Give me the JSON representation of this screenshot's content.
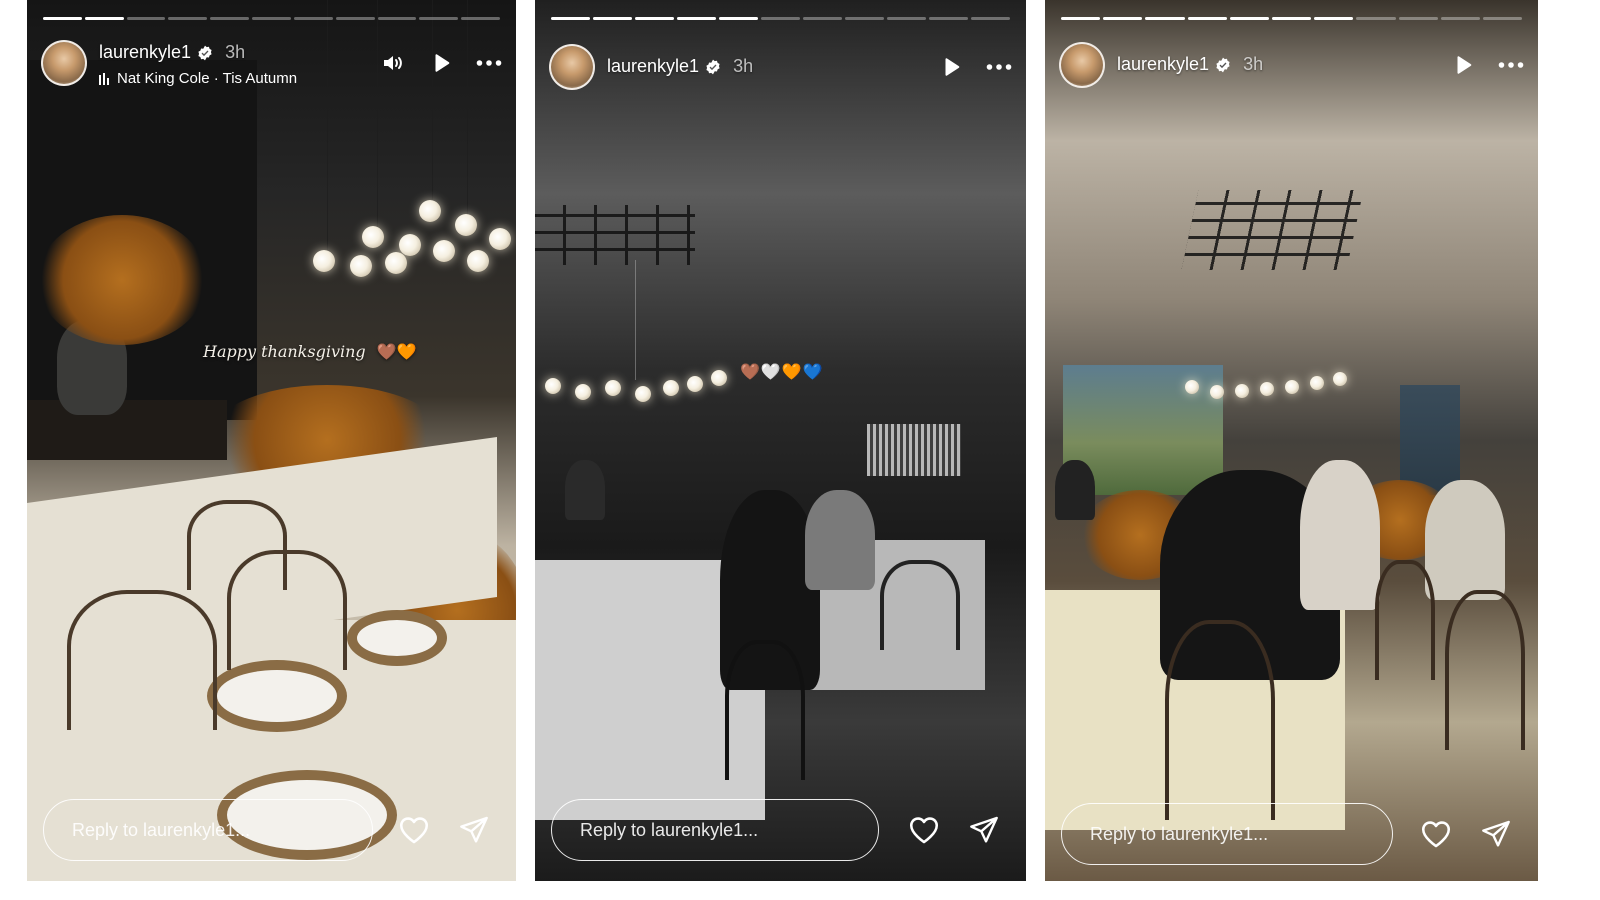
{
  "stories": [
    {
      "progress": {
        "total": 11,
        "done": 2
      },
      "username": "laurenkyle1",
      "time": "3h",
      "music": "Nat King Cole · Tis Autumn",
      "caption": "Happy thanksgiving",
      "caption_emoji": "🤎🧡",
      "reply_placeholder": "Reply to laurenkyle1..."
    },
    {
      "progress": {
        "total": 11,
        "done": 5
      },
      "username": "laurenkyle1",
      "time": "3h",
      "caption_emoji": "🤎🤍🧡💙",
      "reply_placeholder": "Reply to laurenkyle1..."
    },
    {
      "progress": {
        "total": 11,
        "done": 7
      },
      "username": "laurenkyle1",
      "time": "3h",
      "reply_placeholder": "Reply to laurenkyle1..."
    }
  ],
  "icons": {
    "verified": "verified-badge-icon",
    "sound": "speaker-icon",
    "play": "play-icon",
    "more": "more-dots-icon",
    "like": "heart-icon",
    "share": "send-icon"
  },
  "colors": {
    "progress_done": "#ffffff",
    "progress_pending": "rgba(255,255,255,0.35)",
    "text": "#ffffff"
  }
}
